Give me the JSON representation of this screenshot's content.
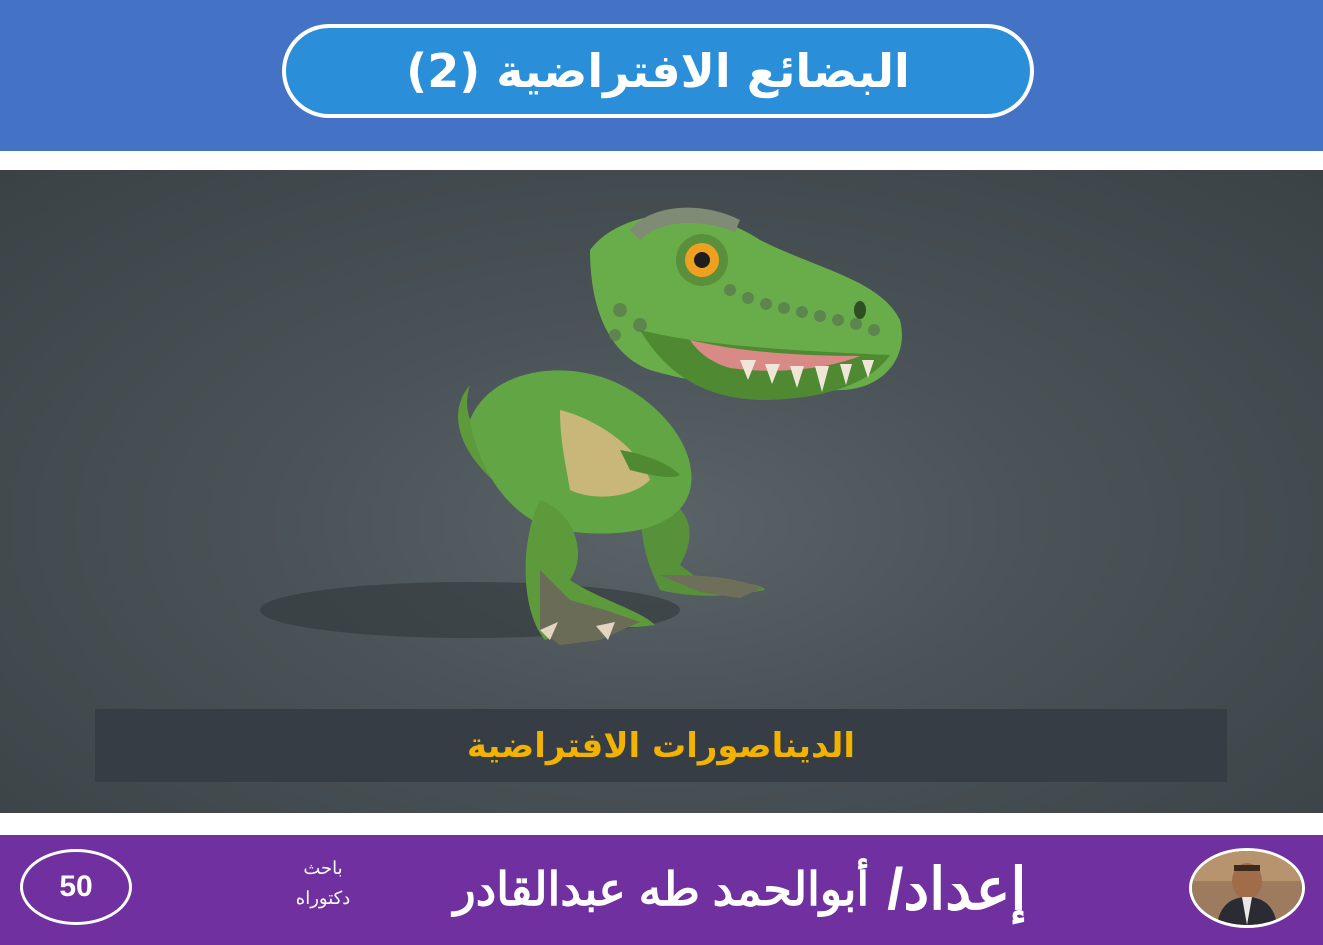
{
  "header": {
    "title": "البضائع الافتراضية (2)"
  },
  "scene": {
    "caption": "الديناصورات الافتراضية"
  },
  "footer": {
    "page_number": "50",
    "degree_line1": "باحث",
    "degree_line2": "دكتوراه",
    "author_prefix": "إعداد/",
    "author_name": "أبوالحمد طه عبدالقادر"
  },
  "colors": {
    "header_bg": "#4472c4",
    "title_pill_bg": "#2a8fd8",
    "footer_bg": "#7030a0",
    "caption_text": "#f2b200"
  }
}
